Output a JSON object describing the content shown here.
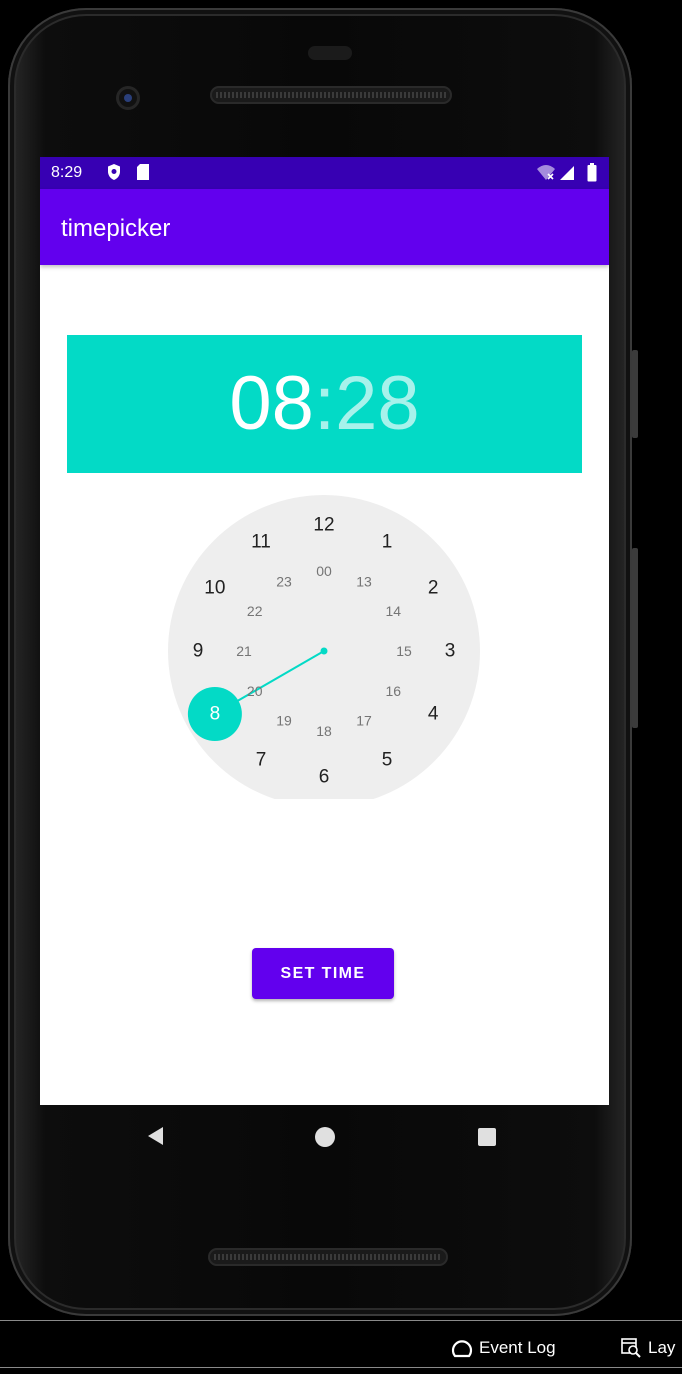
{
  "status_bar": {
    "time": "8:29",
    "icons": [
      "shield-icon",
      "sd-card-icon",
      "wifi-icon",
      "signal-icon",
      "battery-icon"
    ]
  },
  "app": {
    "title": "timepicker"
  },
  "time_display": {
    "hour": "08",
    "separator": ":",
    "minute": "28"
  },
  "clock": {
    "outer_labels": [
      "12",
      "1",
      "2",
      "3",
      "4",
      "5",
      "6",
      "7",
      "8",
      "9",
      "10",
      "11"
    ],
    "inner_labels": [
      "00",
      "13",
      "14",
      "15",
      "16",
      "17",
      "18",
      "19",
      "20",
      "21",
      "22",
      "23"
    ],
    "selected": "8",
    "accent": "#03dac6",
    "face_color": "#eeeeee"
  },
  "button": {
    "label": "SET TIME"
  },
  "navigation": {
    "icons": [
      "back-icon",
      "home-icon",
      "recents-icon"
    ]
  },
  "ide": {
    "event_log": "Event Log",
    "layout": "Lay"
  },
  "colors": {
    "primary": "#6200ee",
    "primary_dark": "#3700b3",
    "secondary": "#03dac6"
  }
}
